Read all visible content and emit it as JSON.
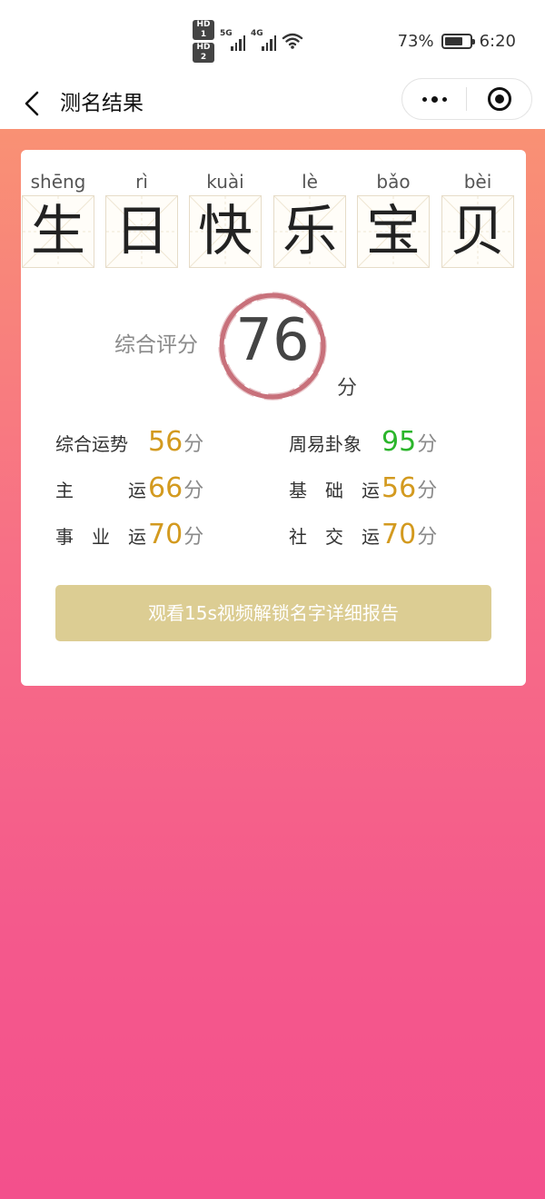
{
  "status_bar": {
    "sim1_badge": "HD 1",
    "sim2_badge": "HD 2",
    "net1": "5G",
    "net2": "4G",
    "battery_percent_text": "73%",
    "battery_level": 0.73,
    "time": "6:20"
  },
  "nav": {
    "title": "测名结果",
    "back_icon": "chevron-left-icon",
    "more_icon": "more-dots-icon",
    "close_icon": "target-ring-icon"
  },
  "name": {
    "chars": [
      {
        "pinyin": "shēng",
        "char": "生"
      },
      {
        "pinyin": "rì",
        "char": "日"
      },
      {
        "pinyin": "kuài",
        "char": "快"
      },
      {
        "pinyin": "lè",
        "char": "乐"
      },
      {
        "pinyin": "bǎo",
        "char": "宝"
      },
      {
        "pinyin": "bèi",
        "char": "贝"
      }
    ]
  },
  "score": {
    "label": "综合评分",
    "value": "76",
    "unit": "分",
    "seal_color": "#b5424f"
  },
  "metrics": [
    {
      "label": "综合运势",
      "value": "56",
      "unit": "分",
      "color": "#d39a1f"
    },
    {
      "label": "周易卦象",
      "value": "95",
      "unit": "分",
      "color": "#2bb52b"
    },
    {
      "label": "主运",
      "value": "66",
      "unit": "分",
      "color": "#d39a1f"
    },
    {
      "label": "基础运",
      "value": "56",
      "unit": "分",
      "color": "#d39a1f"
    },
    {
      "label": "事业运",
      "value": "70",
      "unit": "分",
      "color": "#d39a1f"
    },
    {
      "label": "社交运",
      "value": "70",
      "unit": "分",
      "color": "#d39a1f"
    }
  ],
  "unlock_button": {
    "label": "观看15s视频解锁名字详细报告",
    "color": "#dccd93"
  }
}
